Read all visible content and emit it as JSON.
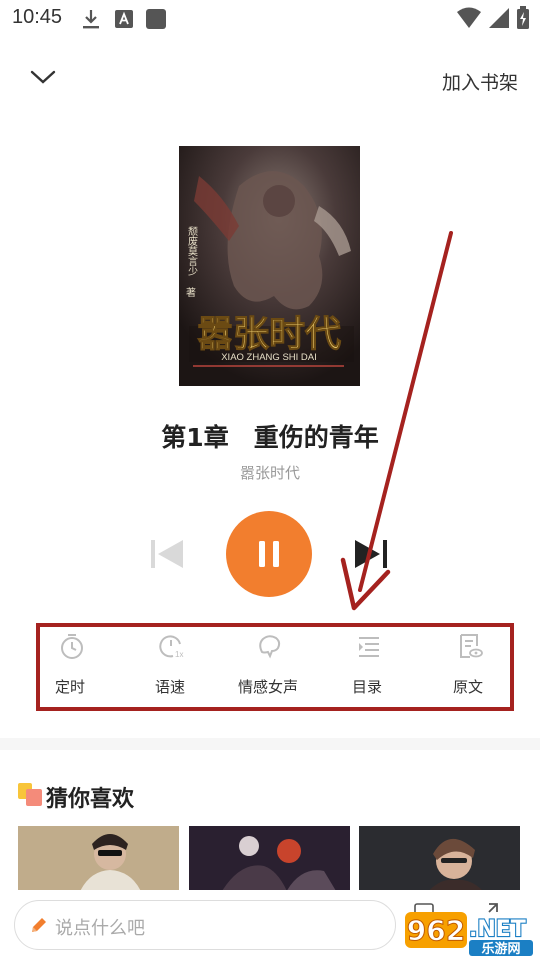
{
  "status_bar": {
    "time": "10:45",
    "icons": [
      "download-icon",
      "font-a-icon",
      "square-icon",
      "wifi-icon",
      "signal-icon",
      "battery-icon"
    ]
  },
  "header": {
    "collapse_icon": "chevron-down-icon",
    "add_to_shelf": "加入书架"
  },
  "book": {
    "cover_title": "嚣张时代",
    "cover_subtitle": "XIAO ZHANG SHI DAI",
    "cover_author": "颓废莫言少",
    "cover_author_suffix": "著",
    "chapter_title": "第1章　重伤的青年",
    "book_name": "嚣张时代"
  },
  "player": {
    "prev_icon": "skip-previous-icon",
    "play_state_icon": "pause-icon",
    "next_icon": "skip-next-icon"
  },
  "functions": [
    {
      "label": "定时",
      "icon": "timer-icon"
    },
    {
      "label": "语速",
      "icon": "speed-icon"
    },
    {
      "label": "情感女声",
      "icon": "voice-icon"
    },
    {
      "label": "目录",
      "icon": "catalog-icon"
    },
    {
      "label": "原文",
      "icon": "original-text-icon"
    }
  ],
  "recommend": {
    "title": "猜你喜欢"
  },
  "bottom": {
    "comment_placeholder": "说点什么吧",
    "watermark_badge": "962",
    "watermark_text": ".NET",
    "watermark_sub": "乐游网"
  },
  "colors": {
    "accent": "#f27e2e",
    "annotation": "#a5221f",
    "muted_icon": "#bdbdbd"
  }
}
